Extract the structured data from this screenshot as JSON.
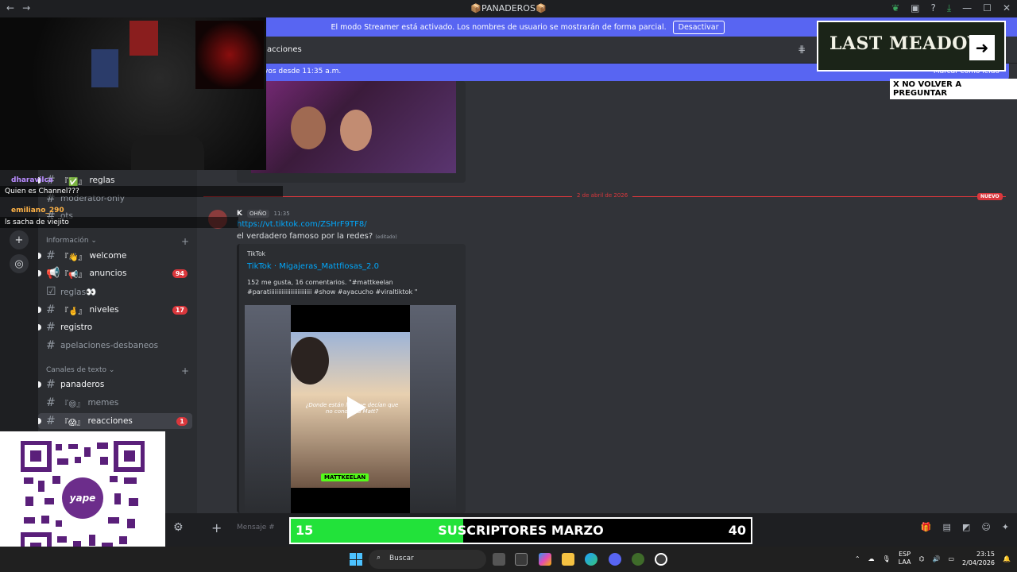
{
  "window": {
    "title": "📦PANADEROS📦"
  },
  "streamer_banner": {
    "text": "El modo Streamer está activado. Los nombres de usuario se mostrarán de forma parcial.",
    "button": "Desactivar"
  },
  "chat": {
    "header_name": "acciones",
    "newbar_left": "vos desde 11:35 a.m.",
    "newbar_right": "Marcar como leído",
    "divider_date": "2 de abril de 2026",
    "divider_new": "NUEVO",
    "message": {
      "user": "K",
      "tag": "OHÑO",
      "time": "11:35",
      "link": "https://vt.tiktok.com/ZSHrF9TF8/",
      "text": "el verdadero famoso por la redes?",
      "edited": "(editado)"
    },
    "embed": {
      "provider": "TikTok",
      "title": "TikTok · Migajeras_Mattfiosas_2.0",
      "description": "152 me gusta, 16 comentarios. \"#mattkeelan #paratiiiiiiiiiiiiiiiiiiiiiiii #show #ayacucho #viraltiktok \"",
      "video_subtitle": "¿Donde están los que decían que no conocía a Matt?",
      "video_badge": "MATTKEELAN"
    },
    "input_placeholder": "Mensaje #"
  },
  "sidebar": {
    "channels_top": [
      {
        "label": "reglas",
        "emoji": "『✅』",
        "unread": true
      },
      {
        "label": "moderator-only",
        "emoji": "",
        "unread": false
      },
      {
        "label": "ots",
        "emoji": "",
        "unread": false
      }
    ],
    "category_info": "Información",
    "channels_info": [
      {
        "label": "welcome",
        "emoji": "『👋』",
        "unread": true,
        "badge": ""
      },
      {
        "label": "anuncios",
        "emoji": "『📢』",
        "unread": true,
        "badge": "94"
      },
      {
        "label": "reglas👀",
        "emoji": "",
        "unread": false,
        "badge": ""
      },
      {
        "label": "niveles",
        "emoji": "『🤞』",
        "unread": true,
        "badge": "17"
      },
      {
        "label": "registro",
        "emoji": "",
        "unread": true,
        "badge": ""
      },
      {
        "label": "apelaciones-desbaneos",
        "emoji": "",
        "unread": false,
        "badge": ""
      }
    ],
    "category_text": "Canales de texto",
    "channels_text": [
      {
        "label": "panaderos",
        "emoji": "",
        "unread": true,
        "badge": ""
      },
      {
        "label": "memes",
        "emoji": "『😄』",
        "unread": false,
        "badge": ""
      },
      {
        "label": "reacciones",
        "emoji": "『😱』",
        "unread": true,
        "badge": "1",
        "active": true
      }
    ]
  },
  "stream_chat": [
    {
      "user": "dharavilca",
      "message": "Quien es Channel???",
      "color": "#b98cff"
    },
    {
      "user": "emiliano_290",
      "message": "ls sacha de viejito",
      "color": "#ffb347"
    }
  ],
  "ad": {
    "title": "LAST MEADOW",
    "cta": "X NO VOLVER A PREGUNTAR"
  },
  "qr": {
    "brand": "yape"
  },
  "subs_goal": {
    "current": "15",
    "label": "SUSCRIPTORES MARZO",
    "target": "40",
    "progress": 0.375
  },
  "taskbar": {
    "search": "Buscar",
    "lang_top": "ESP",
    "lang_bottom": "LAA",
    "time": "23:15",
    "date": "2/04/2026"
  },
  "colors": {
    "accent": "#5865f2",
    "danger": "#da373c",
    "link": "#00a8fc",
    "goal": "#22e23a"
  }
}
